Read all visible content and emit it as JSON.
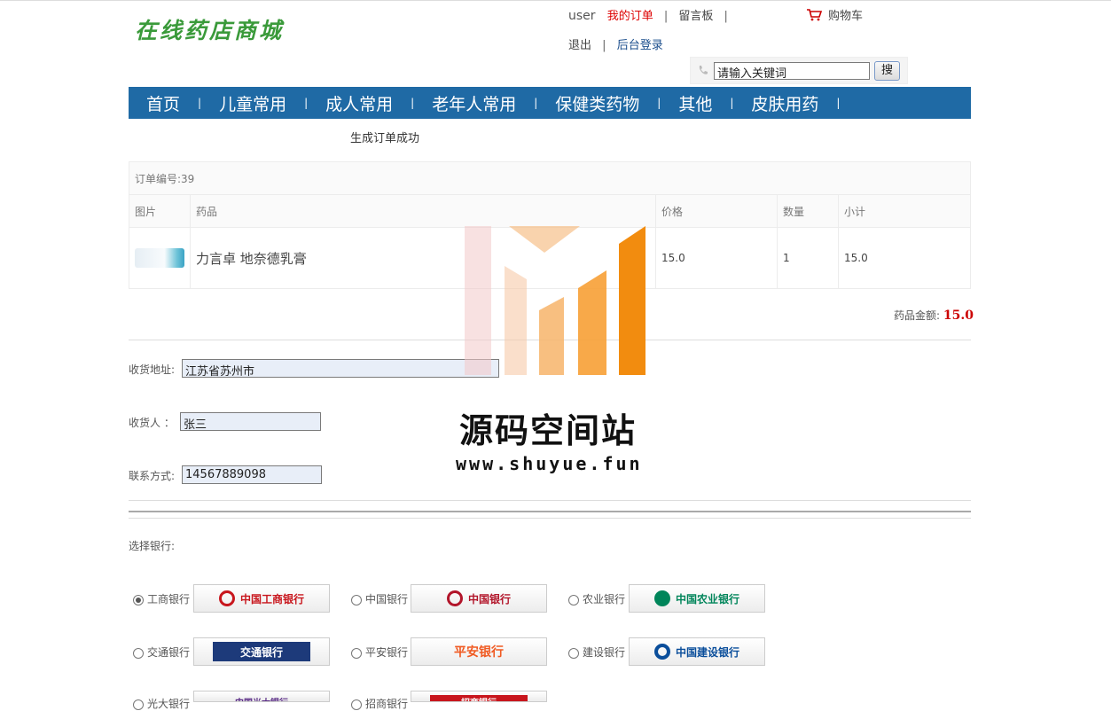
{
  "site": {
    "logo": "在线药店商城"
  },
  "topbar": {
    "user": "user",
    "my_orders": "我的订单",
    "guestbook": "留言板",
    "cart": "购物车",
    "logout": "退出",
    "admin_login": "后台登录",
    "sep": "|"
  },
  "search": {
    "placeholder": "请输入关键词",
    "button": "搜"
  },
  "nav": {
    "items": [
      "首页",
      "儿童常用",
      "成人常用",
      "老年人常用",
      "保健类药物",
      "其他",
      "皮肤用药"
    ],
    "sep": "|"
  },
  "message": "生成订单成功",
  "order": {
    "number_label": "订单编号:39",
    "headers": {
      "image": "图片",
      "drug": "药品",
      "price": "价格",
      "qty": "数量",
      "subtotal": "小计"
    },
    "items": [
      {
        "name": "力言卓 地奈德乳膏",
        "price": "15.0",
        "qty": "1",
        "subtotal": "15.0"
      }
    ],
    "total_label": "药品金额:",
    "total_value": "15.0"
  },
  "form": {
    "address_label": "收货地址:",
    "address_value": "江苏省苏州市",
    "receiver_label": "收货人 ：",
    "receiver_value": "张三",
    "contact_label": "联系方式:",
    "contact_value": "14567889098"
  },
  "banks": {
    "title": "选择银行:",
    "options": [
      {
        "label": "工商银行",
        "logo_text": "中国工商银行",
        "selected": true,
        "color": "#c8161d"
      },
      {
        "label": "中国银行",
        "logo_text": "中国银行",
        "selected": false,
        "color": "#b2152a"
      },
      {
        "label": "农业银行",
        "logo_text": "中国农业银行",
        "selected": false,
        "color": "#00855a"
      },
      {
        "label": "交通银行",
        "logo_text": "交通银行",
        "selected": false,
        "color": "#1d3a7a"
      },
      {
        "label": "平安银行",
        "logo_text": "平安银行",
        "selected": false,
        "color": "#f05a22"
      },
      {
        "label": "建设银行",
        "logo_text": "中国建设银行",
        "selected": false,
        "color": "#0a4e9b"
      },
      {
        "label": "光大银行",
        "logo_text": "中国光大银行",
        "selected": false,
        "color": "#5b2d87"
      },
      {
        "label": "招商银行",
        "logo_text": "招商银行",
        "selected": false,
        "color": "#c8161d"
      }
    ]
  },
  "watermark": {
    "title": "源码空间站",
    "url": "www.shuyue.fun"
  }
}
